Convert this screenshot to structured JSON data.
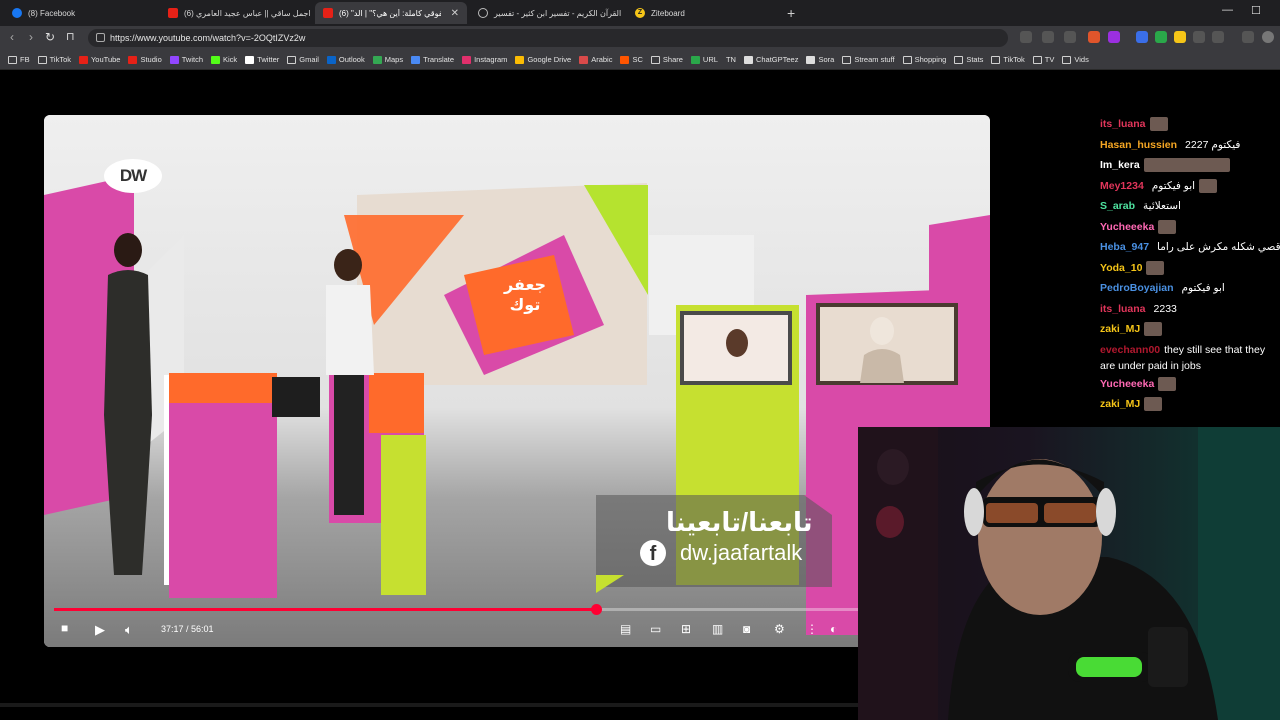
{
  "browser": {
    "tabs": [
      {
        "title": "(8) Facebook",
        "icon": "facebook-icon"
      },
      {
        "title": "(6) اجمل ساقي || عباس عجيد العامري",
        "icon": "youtube-icon"
      },
      {
        "title": "(6) \"حقوقي كاملة: أين هي؟\" | الد",
        "icon": "youtube-icon",
        "active": true
      },
      {
        "title": "القرآن الكريم - تفسير ابن كثير - تفسير",
        "icon": "globe-icon"
      },
      {
        "title": "Ziteboard",
        "icon": "ziteboard-icon"
      }
    ],
    "url": "https://www.youtube.com/watch?v=-2OQtIZVz2w",
    "bookmarks": [
      {
        "label": "FB",
        "icon": "folder-icon"
      },
      {
        "label": "TikTok",
        "icon": "folder-icon"
      },
      {
        "label": "YouTube",
        "icon": "youtube-icon"
      },
      {
        "label": "Studio",
        "icon": "youtube-icon"
      },
      {
        "label": "Twitch",
        "icon": "twitch-icon"
      },
      {
        "label": "Kick",
        "icon": "kick-icon"
      },
      {
        "label": "Twitter",
        "icon": "x-icon"
      },
      {
        "label": "Gmail",
        "icon": "folder-icon"
      },
      {
        "label": "Outlook",
        "icon": "outlook-icon"
      },
      {
        "label": "Maps",
        "icon": "maps-icon"
      },
      {
        "label": "Translate",
        "icon": "translate-icon"
      },
      {
        "label": "Instagram",
        "icon": "instagram-icon"
      },
      {
        "label": "Google Drive",
        "icon": "drive-icon"
      },
      {
        "label": "Arabic",
        "icon": "arabic-icon"
      },
      {
        "label": "SC",
        "icon": "sc-icon"
      },
      {
        "label": "Share",
        "icon": "folder-icon"
      },
      {
        "label": "URL",
        "icon": "url-icon"
      },
      {
        "label": "TN",
        "icon": "none"
      },
      {
        "label": "ChatGPTeez",
        "icon": "chatgpt-icon"
      },
      {
        "label": "Sora",
        "icon": "sora-icon"
      },
      {
        "label": "Stream stuff",
        "icon": "folder-icon"
      },
      {
        "label": "Shopping",
        "icon": "folder-icon"
      },
      {
        "label": "Stats",
        "icon": "folder-icon"
      },
      {
        "label": "TikTok",
        "icon": "folder-icon"
      },
      {
        "label": "TV",
        "icon": "folder-icon"
      },
      {
        "label": "Vids",
        "icon": "folder-icon"
      }
    ]
  },
  "video": {
    "overlay_follow": "تابعنا/تابعينا",
    "overlay_handle": "dw.jaafartalk",
    "logo": "DW",
    "set_logo": "جعفر توك",
    "time_current": "37:17",
    "time_total": "56:01",
    "time_display": "37:17 / 56:01",
    "progress": 0.6655
  },
  "chat": [
    {
      "user": "its_luana",
      "color": "#e0355a",
      "text": "",
      "emote": true
    },
    {
      "user": "Hasan_hussien",
      "color": "#f5a623",
      "text": "فيكتوم 2227"
    },
    {
      "user": "Im_kera",
      "color": "#ffffff",
      "text": "",
      "emote": true
    },
    {
      "user": "Mey1234",
      "color": "#e0355a",
      "text": "ابو فيكتوم",
      "emote": true
    },
    {
      "user": "S_arab",
      "color": "#4fe3a0",
      "text": "استعلائية"
    },
    {
      "user": "Yucheeeka",
      "color": "#ff69b4",
      "text": "",
      "emote": true
    },
    {
      "user": "Heba_947",
      "color": "#4a90e2",
      "text": "قصي شكله مكرش على راما"
    },
    {
      "user": "Yoda_10",
      "color": "#f5c518",
      "text": "",
      "emote": true
    },
    {
      "user": "PedroBoyajian",
      "color": "#4a90e2",
      "text": "ابو فيكتوم"
    },
    {
      "user": "its_luana",
      "color": "#e0355a",
      "text": "2233"
    },
    {
      "user": "zaki_MJ",
      "color": "#f5c518",
      "text": "",
      "emote": true
    },
    {
      "user": "evechann00",
      "color": "#b0182e",
      "text": "they still see that they are under paid in jobs"
    },
    {
      "user": "Yucheeeka",
      "color": "#ff69b4",
      "text": "",
      "emote": true
    },
    {
      "user": "zaki_MJ",
      "color": "#f5c518",
      "text": "",
      "emote": true
    }
  ]
}
